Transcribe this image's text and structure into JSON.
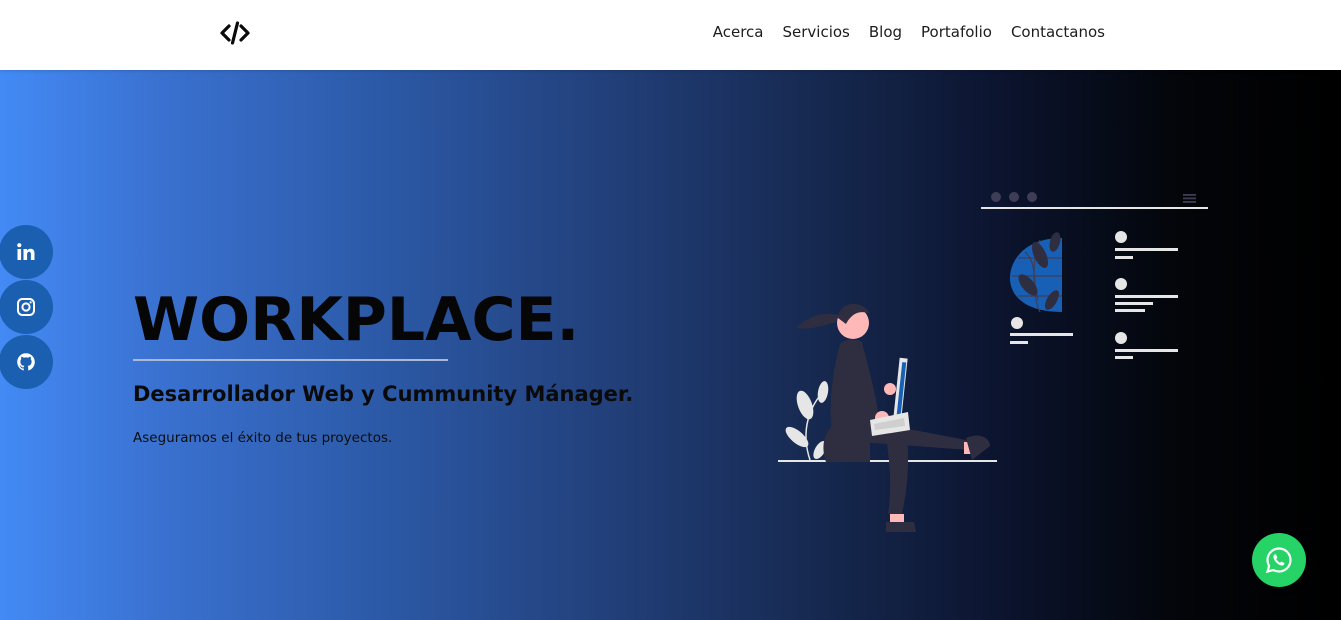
{
  "nav": {
    "logo_icon": "code-brackets-icon",
    "links": [
      "Acerca",
      "Servicios",
      "Blog",
      "Portafolio",
      "Contactanos"
    ]
  },
  "hero": {
    "title": "WORKPLACE.",
    "subtitle": "Desarrollador Web y Cummunity Mánager.",
    "tagline": "Aseguramos el éxito de tus proyectos."
  },
  "social": [
    "linkedin-icon",
    "instagram-icon",
    "github-icon"
  ],
  "floating": {
    "whatsapp_icon": "whatsapp-icon"
  },
  "colors": {
    "gradient_start": "#438af5",
    "gradient_end": "#000000",
    "social_bg": "#1a5fb0",
    "whatsapp_bg": "#25d366",
    "accent_blue": "#1760b5"
  }
}
